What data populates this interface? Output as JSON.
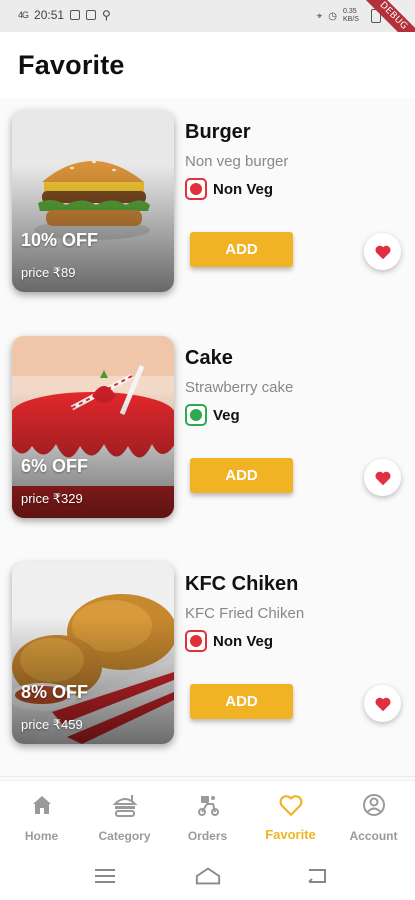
{
  "status": {
    "time": "20:51",
    "signal": "4G",
    "speed": "0.35 KB/S"
  },
  "debug_banner": "DEBUG",
  "header": {
    "title": "Favorite"
  },
  "items": [
    {
      "name": "Burger",
      "description": "Non veg burger",
      "type": "Non Veg",
      "is_veg": false,
      "discount": "10% OFF",
      "price": "price ₹89",
      "add_label": "ADD",
      "favorited": true
    },
    {
      "name": "Cake",
      "description": "Strawberry cake",
      "type": "Veg",
      "is_veg": true,
      "discount": "6% OFF",
      "price": "price ₹329",
      "add_label": "ADD",
      "favorited": true
    },
    {
      "name": "KFC Chiken",
      "description": "KFC Fried Chiken",
      "type": "Non Veg",
      "is_veg": false,
      "discount": "8% OFF",
      "price": "price ₹459",
      "add_label": "ADD",
      "favorited": true
    }
  ],
  "nav": [
    {
      "label": "Home",
      "icon": "home-icon"
    },
    {
      "label": "Category",
      "icon": "category-icon"
    },
    {
      "label": "Orders",
      "icon": "orders-icon"
    },
    {
      "label": "Favorite",
      "icon": "heart-outline-icon",
      "active": true
    },
    {
      "label": "Account",
      "icon": "account-icon"
    }
  ],
  "colors": {
    "accent": "#f0b323",
    "heart": "#e02f45",
    "veg": "#2fa84f",
    "nonveg": "#e0313b"
  }
}
